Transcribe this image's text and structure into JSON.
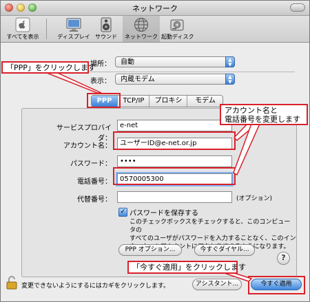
{
  "window": {
    "title": "ネットワーク"
  },
  "toolbar": {
    "items": [
      {
        "label": "すべてを表示",
        "icon": "apple-grid-icon"
      },
      {
        "label": "ディスプレイ",
        "icon": "display-icon"
      },
      {
        "label": "サウンド",
        "icon": "speaker-icon"
      },
      {
        "label": "ネットワーク",
        "icon": "network-globe-icon"
      },
      {
        "label": "起動ディスク",
        "icon": "disk-icon"
      }
    ],
    "selected": "ネットワーク"
  },
  "location": {
    "label": "場所：",
    "value": "自動"
  },
  "show": {
    "label": "表示：",
    "value": "内蔵モデム"
  },
  "tabs": [
    "PPP",
    "TCP/IP",
    "プロキシ",
    "モデム"
  ],
  "selected_tab": "PPP",
  "form": {
    "provider": {
      "label": "サービスプロバイダ：",
      "value": "e-net"
    },
    "account": {
      "label": "アカウント名：",
      "value": "ユーザーID@e-net.or.jp"
    },
    "password": {
      "label": "パスワード：",
      "value": "••••"
    },
    "phone": {
      "label": "電話番号：",
      "value": "0570005300"
    },
    "alt_phone": {
      "label": "代替番号：",
      "value": "",
      "note": "(オプション)"
    },
    "save_password": {
      "label": "パスワードを保存する",
      "checked": true,
      "description": [
        "このチェックボックスをチェックすると、このコンピュータの",
        "すべてのユーザがパスワードを入力することなく、このイン",
        "ターネットアカウントにアクセスできるようになります。"
      ]
    }
  },
  "buttons": {
    "ppp_options": "PPP オプション...",
    "dial_now": "今すぐダイヤル...",
    "help": "?",
    "assistant": "アシスタント...",
    "apply_now": "今すぐ適用"
  },
  "footer": {
    "lock_text": "変更できないようにするにはカギをクリックします。"
  },
  "annotations": {
    "ppp_click": "「PPP」をクリックします",
    "account_phone": [
      "アカウント名と",
      "電話番号を変更します"
    ],
    "apply_click": "「今すぐ適用」をクリックします"
  },
  "colors": {
    "annotation_red": "#d9202a",
    "accent_blue": "#3f86db"
  }
}
